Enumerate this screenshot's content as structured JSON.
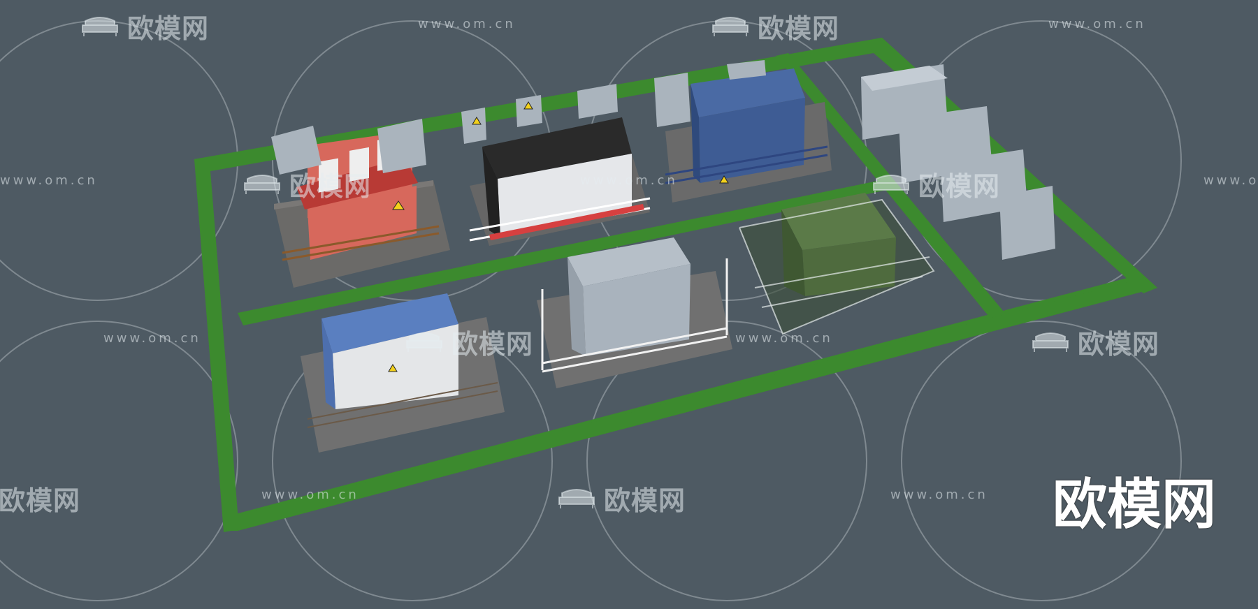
{
  "watermark": {
    "brand": "欧模网",
    "url": "www.om.cn"
  },
  "corner_mark": "欧模网",
  "colors": {
    "background": "#4e5a63",
    "grass": "#3c8a2e",
    "red_house": "#d7685c",
    "red_roof": "#b83a35",
    "black_roof": "#2a2a2a",
    "blue_box": "#3e5c94",
    "green_box": "#4f6b3e",
    "grey_box": "#a9b3bd",
    "blue_roof": "#5a7fc0"
  },
  "icons": [
    "sofa-logo-icon",
    "warning-triangle-icon"
  ]
}
